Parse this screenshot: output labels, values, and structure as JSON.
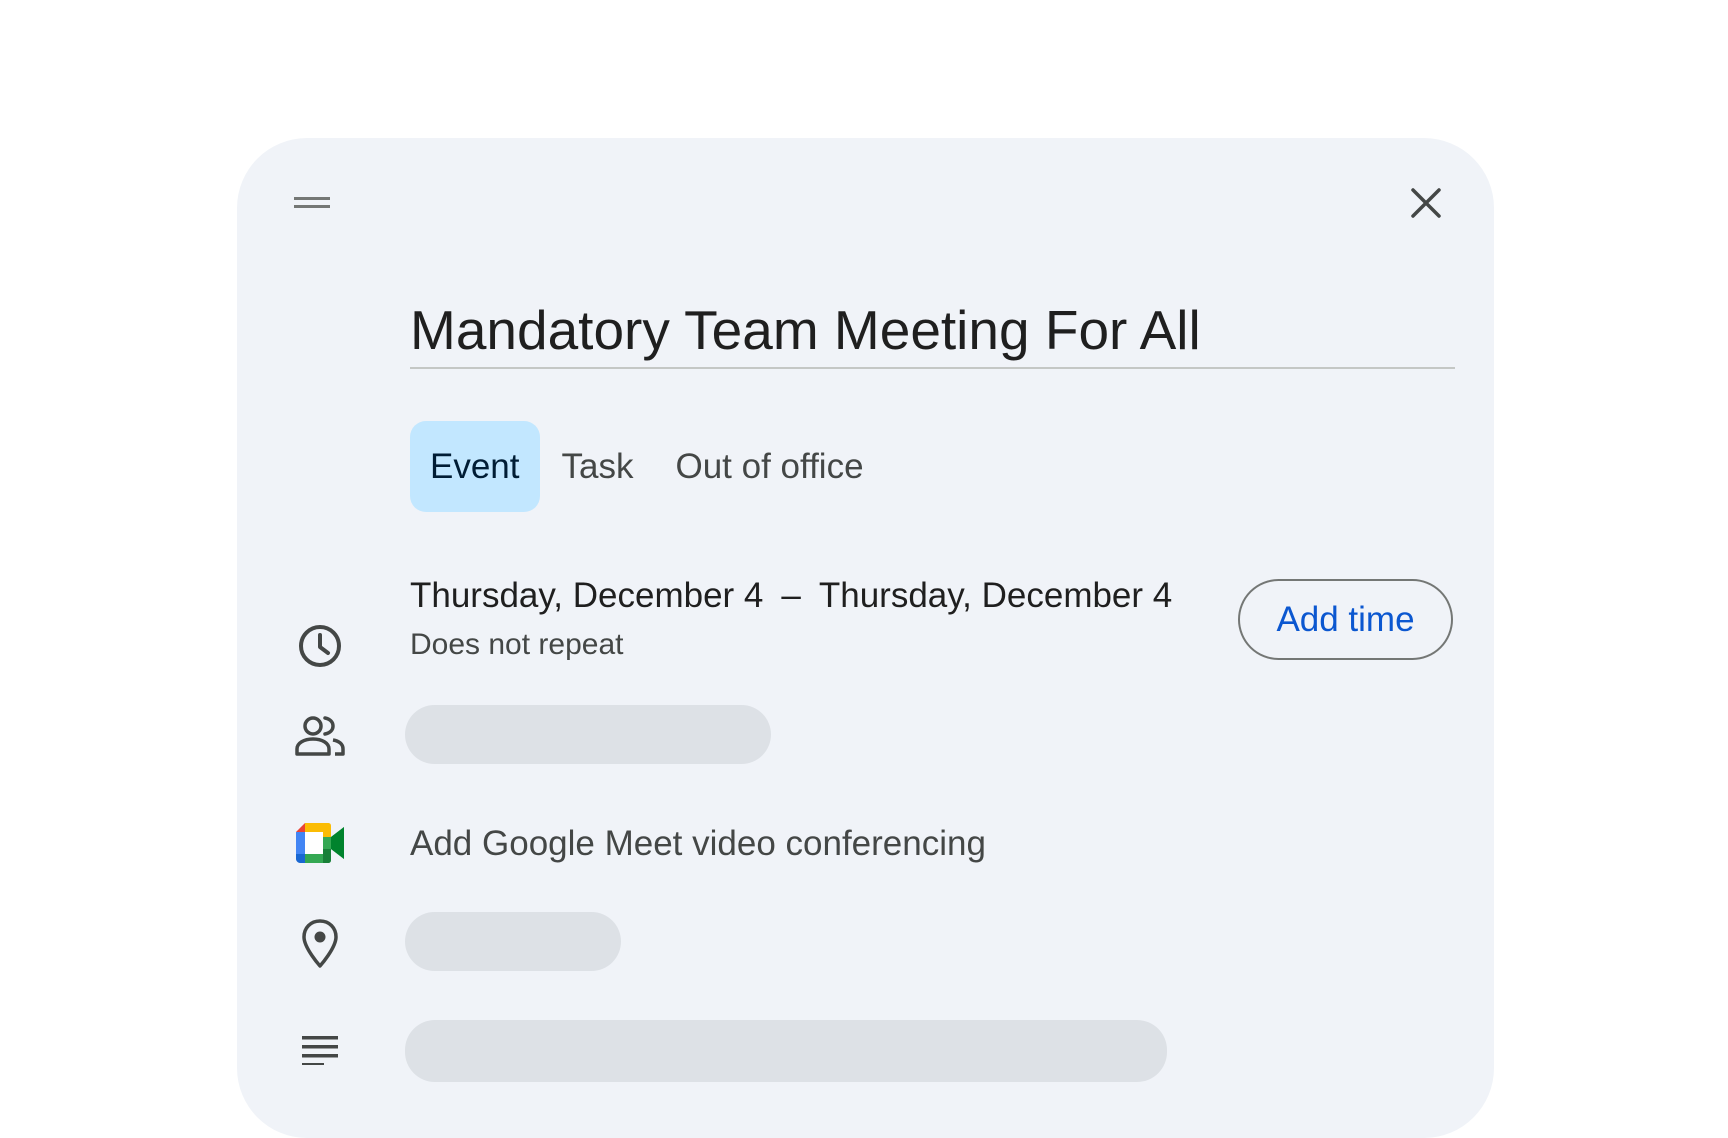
{
  "event": {
    "title": "Mandatory Team Meeting For All",
    "tabs": [
      {
        "label": "Event",
        "active": true
      },
      {
        "label": "Task",
        "active": false
      },
      {
        "label": "Out of office",
        "active": false
      }
    ],
    "start_date": "Thursday, December 4",
    "date_separator": "–",
    "end_date": "Thursday, December 4",
    "repeat": "Does not repeat",
    "add_time_label": "Add time",
    "meet_label": "Add Google Meet video conferencing"
  },
  "icons": {
    "drag": "drag-handle-icon",
    "close": "close-icon",
    "time": "clock-icon",
    "guests": "people-icon",
    "meet": "google-meet-icon",
    "location": "location-pin-icon",
    "description": "notes-icon"
  },
  "colors": {
    "card_background": "#f0f3f8",
    "active_tab": "#c2e7ff",
    "accent": "#0b57d0",
    "skeleton": "#dde1e6"
  }
}
